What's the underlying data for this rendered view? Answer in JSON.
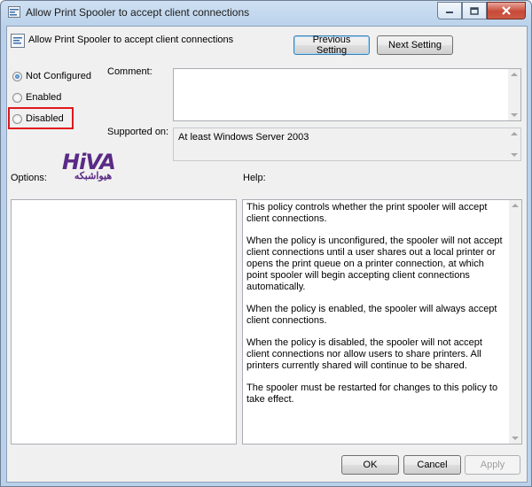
{
  "window": {
    "title": "Allow Print Spooler to accept client connections",
    "minimize_icon": "minimize-icon",
    "maximize_icon": "maximize-icon",
    "close_icon": "close-icon"
  },
  "header": {
    "policy_title": "Allow Print Spooler to accept client connections",
    "previous_label": "Previous Setting",
    "next_label": "Next Setting"
  },
  "state": {
    "options": [
      {
        "label": "Not Configured",
        "selected": true
      },
      {
        "label": "Enabled",
        "selected": false
      },
      {
        "label": "Disabled",
        "selected": false
      }
    ],
    "highlight_color": "#e0171c"
  },
  "comment": {
    "label": "Comment:",
    "value": ""
  },
  "supported": {
    "label": "Supported on:",
    "value": "At least Windows Server 2003"
  },
  "watermark": {
    "logo_text": "HiVA",
    "persian_text": "هیواشبکه",
    "color": "#5a2a86"
  },
  "options_panel": {
    "label": "Options:"
  },
  "help_panel": {
    "label": "Help:",
    "paragraphs": [
      "This policy controls whether the print spooler will accept client connections.",
      "When the policy is unconfigured, the spooler will not accept client connections until a user shares out a local printer or opens the print queue on a printer connection, at which point spooler will begin accepting client connections automatically.",
      "When the policy is enabled, the spooler will always accept client connections.",
      "When the policy is disabled, the spooler will not accept client connections nor allow users to share printers.  All printers currently shared will continue to be shared.",
      "The spooler must be restarted for changes to this policy to take effect."
    ]
  },
  "footer": {
    "ok_label": "OK",
    "cancel_label": "Cancel",
    "apply_label": "Apply"
  }
}
